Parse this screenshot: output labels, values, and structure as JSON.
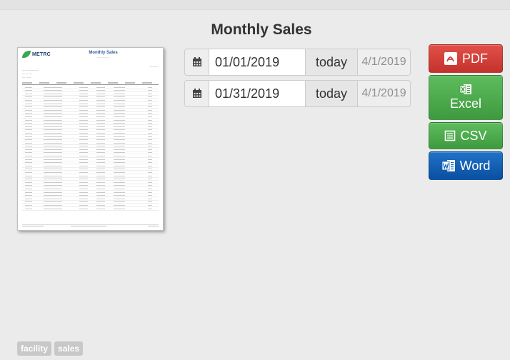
{
  "page": {
    "title": "Monthly Sales"
  },
  "thumbnail": {
    "brand": "METRC",
    "report_title": "Monthly Sales"
  },
  "date_range": [
    {
      "value": "01/01/2019",
      "today_label": "today",
      "hint": "4/1/2019"
    },
    {
      "value": "01/31/2019",
      "today_label": "today",
      "hint": "4/1/2019"
    }
  ],
  "export": {
    "pdf": "PDF",
    "excel": "Excel",
    "csv": "CSV",
    "word": "Word"
  },
  "tags": [
    "facility",
    "sales"
  ],
  "icons": {
    "calendar": "calendar-icon",
    "pdf": "pdf-icon",
    "excel": "excel-icon",
    "csv": "csv-icon",
    "word": "word-icon"
  },
  "colors": {
    "pdf": "#d9403a",
    "excel": "#4cae4c",
    "csv": "#4cae4c",
    "word": "#0f5fb5"
  }
}
